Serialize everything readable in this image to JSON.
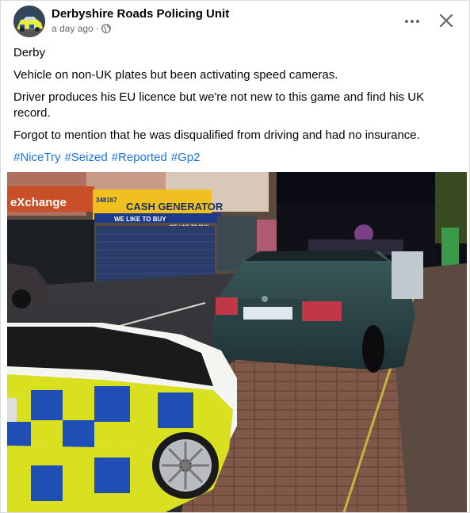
{
  "post": {
    "author": "Derbyshire Roads Policing Unit",
    "time": "a day ago",
    "separator": "·",
    "paragraphs": [
      "Derby",
      "Vehicle on non-UK plates but been activating speed cameras.",
      "Driver produces his EU  licence but we're not new to this game and find his UK record.",
      "Forgot to mention that he was disqualified from driving and had no insurance."
    ],
    "hashtags": [
      "#NiceTry",
      "#Seized",
      "#Reported",
      "#Gp2"
    ]
  },
  "photo": {
    "shop_signs": [
      "eXchange",
      "CASH GENERATOR",
      "WE LIKE TO BUY",
      "WE LIKE TO BUY",
      "348167"
    ]
  },
  "icons": {
    "avatar": "police-car-avatar",
    "privacy": "globe-icon",
    "more": "more-options-icon",
    "close": "close-icon"
  },
  "colors": {
    "link": "#1b74e4",
    "secondary_text": "#65676b",
    "police_yellow": "#d9e020",
    "police_blue": "#1f4fb5"
  }
}
